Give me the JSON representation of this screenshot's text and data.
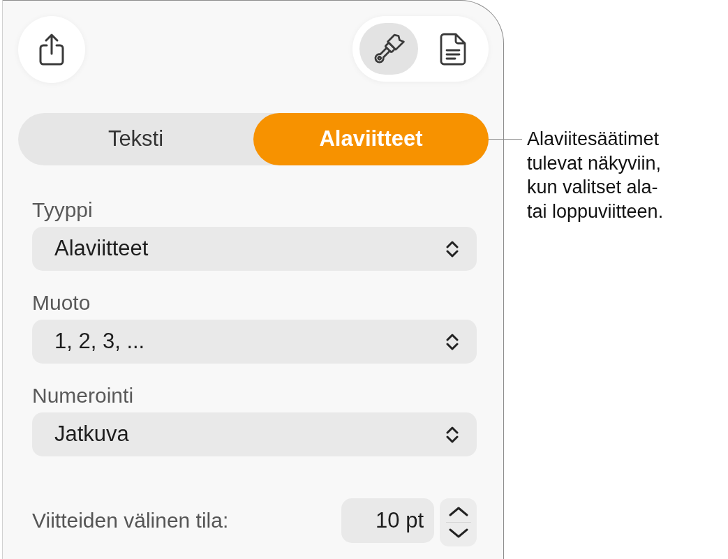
{
  "toolbar": {
    "inspector_tabs": [
      {
        "kind": "format",
        "selected": true
      },
      {
        "kind": "document",
        "selected": false
      }
    ]
  },
  "segments": [
    {
      "label": "Teksti",
      "selected": false
    },
    {
      "label": "Alaviitteet",
      "selected": true
    }
  ],
  "popups": [
    {
      "label": "Tyyppi",
      "value": "Alaviitteet"
    },
    {
      "label": "Muoto",
      "value": "1, 2, 3, ..."
    },
    {
      "label": "Numerointi",
      "value": "Jatkuva"
    }
  ],
  "spacing": {
    "label": "Viitteiden välinen tila:",
    "value": "10 pt"
  },
  "callout": {
    "text": "Alaviitesäätimet tulevat näkyviin, kun valitset ala- tai loppuviitteen."
  }
}
